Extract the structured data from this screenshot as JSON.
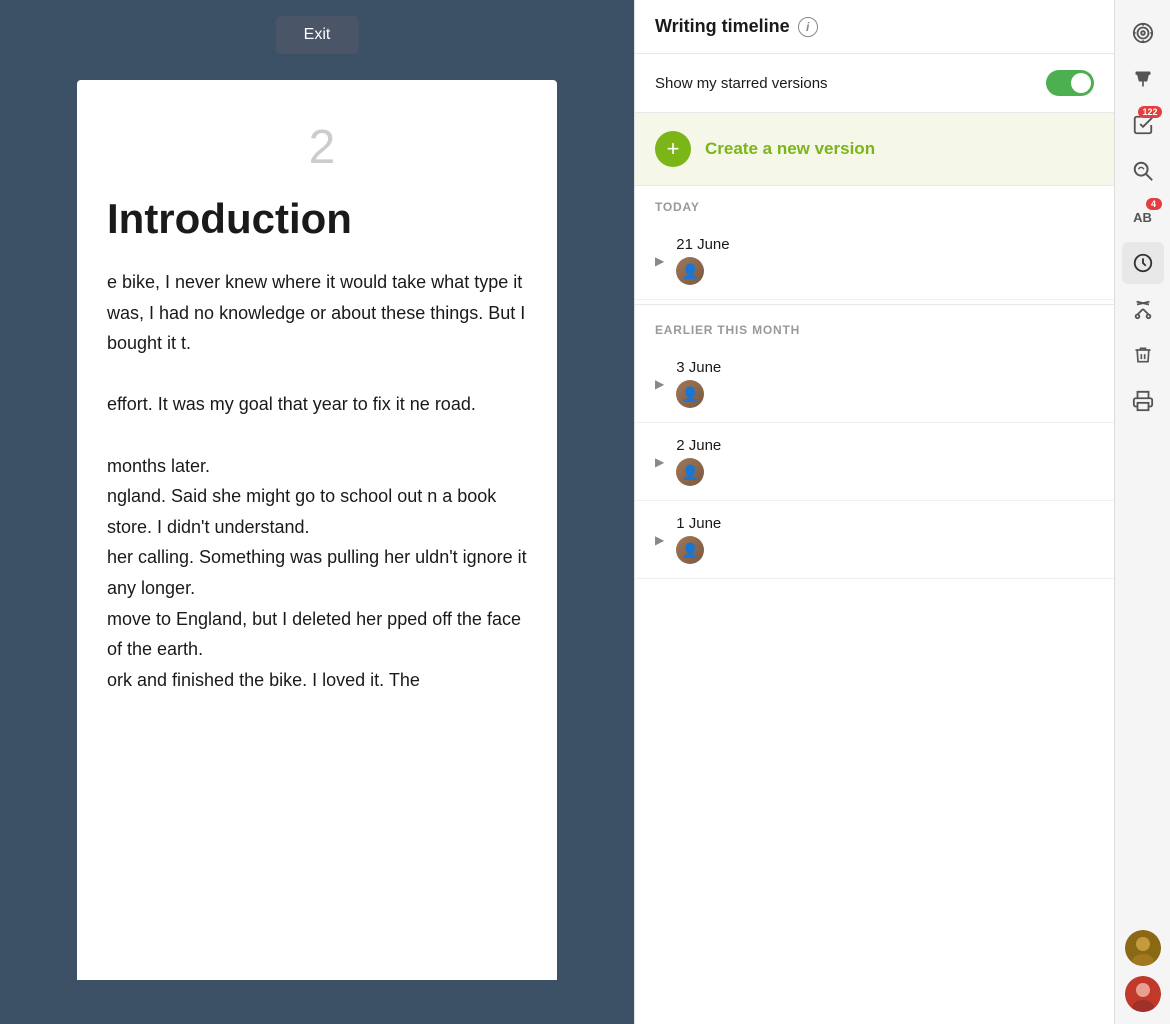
{
  "editor": {
    "exit_button": "Exit",
    "page_number": "2",
    "title": "Introduction",
    "content": "e bike, I never knew where it would take what type it was, I had no knowledge or about these things. But I bought it t.\n\neffort. It was my goal that year to fix it ne road.\n\nmonths later.\nngland. Said she might go to school out n a book store. I didn't understand.\nher calling. Something was pulling her uldn't ignore it any longer.\nmove to England, but I deleted her pped off the face of the earth.\nork and finished the bike. I loved it. The"
  },
  "timeline": {
    "title": "Writing timeline",
    "info_icon": "i",
    "starred_label": "Show my starred versions",
    "toggle_on": true,
    "create_version_label": "Create a new version",
    "sections": [
      {
        "label": "TODAY",
        "items": [
          {
            "date": "21 June"
          }
        ]
      },
      {
        "label": "EARLIER THIS MONTH",
        "items": [
          {
            "date": "3 June"
          },
          {
            "date": "2 June"
          },
          {
            "date": "1 June"
          }
        ]
      }
    ]
  },
  "toolbar": {
    "icons": [
      {
        "name": "goal-icon",
        "symbol": "🎯",
        "badge": null
      },
      {
        "name": "pin-icon",
        "symbol": "📌",
        "badge": null
      },
      {
        "name": "tasks-icon",
        "symbol": "✔",
        "badge": "122"
      },
      {
        "name": "search-icon",
        "symbol": "🔍",
        "badge": null
      },
      {
        "name": "spellcheck-icon",
        "symbol": "AB",
        "badge": "4"
      },
      {
        "name": "history-icon",
        "symbol": "🕐",
        "badge": null,
        "active": true
      },
      {
        "name": "cut-icon",
        "symbol": "✂",
        "badge": null
      },
      {
        "name": "trash-icon",
        "symbol": "🗑",
        "badge": null
      },
      {
        "name": "print-icon",
        "symbol": "🖨",
        "badge": null
      }
    ],
    "users": [
      {
        "name": "user-avatar-1"
      },
      {
        "name": "user-avatar-2"
      }
    ]
  }
}
